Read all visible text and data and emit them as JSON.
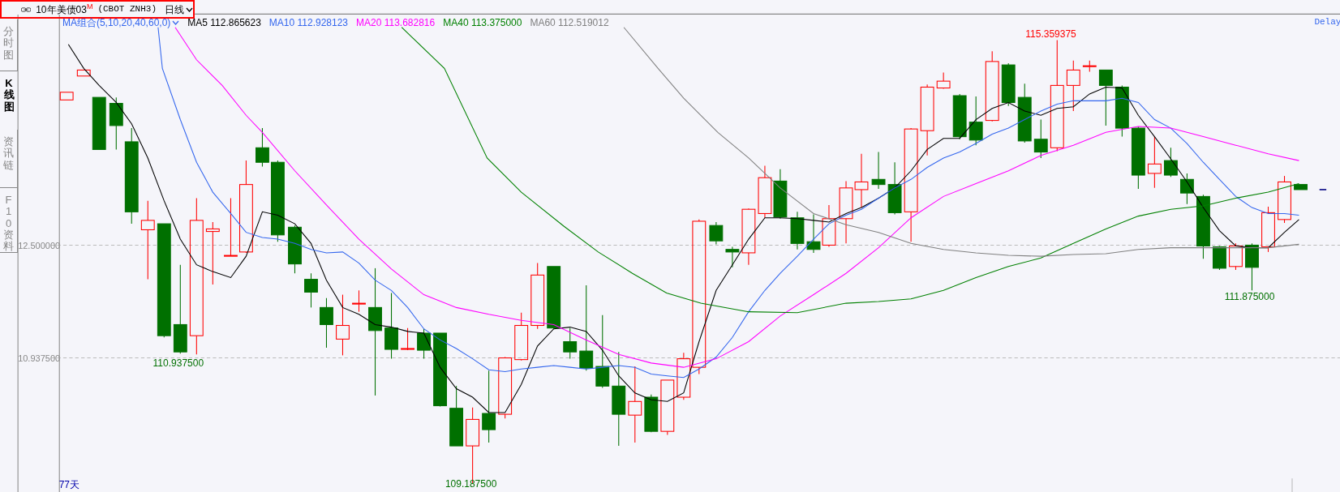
{
  "header": {
    "title": "10年美债03",
    "title_mark": "M",
    "code": "(CBOT ZNH3)",
    "period": "日线"
  },
  "side_tabs": [
    {
      "label": "分时图",
      "selected": false
    },
    {
      "label": "K线图",
      "selected": true
    },
    {
      "label": "资讯链",
      "selected": false
    },
    {
      "label": "F10资料",
      "selected": false
    }
  ],
  "legend": {
    "group": "MA组合(5,10,20,40,60,0)",
    "items": [
      {
        "label": "MA5 112.865623",
        "color": "#000000"
      },
      {
        "label": "MA10 112.928123",
        "color": "#3366ee"
      },
      {
        "label": "MA20 113.682816",
        "color": "#ff00ff"
      },
      {
        "label": "MA40 113.375000",
        "color": "#008000"
      },
      {
        "label": "MA60 112.519012",
        "color": "#808080"
      }
    ]
  },
  "price_axis": [
    "12.500000",
    "10.937500"
  ],
  "delay": "Delay",
  "days": "77天",
  "annotations": [
    {
      "text": "115.359375",
      "kind": "high"
    },
    {
      "text": "110.937500",
      "kind": "low"
    },
    {
      "text": "109.187500",
      "kind": "low"
    },
    {
      "text": "111.875000",
      "kind": "low"
    }
  ]
}
